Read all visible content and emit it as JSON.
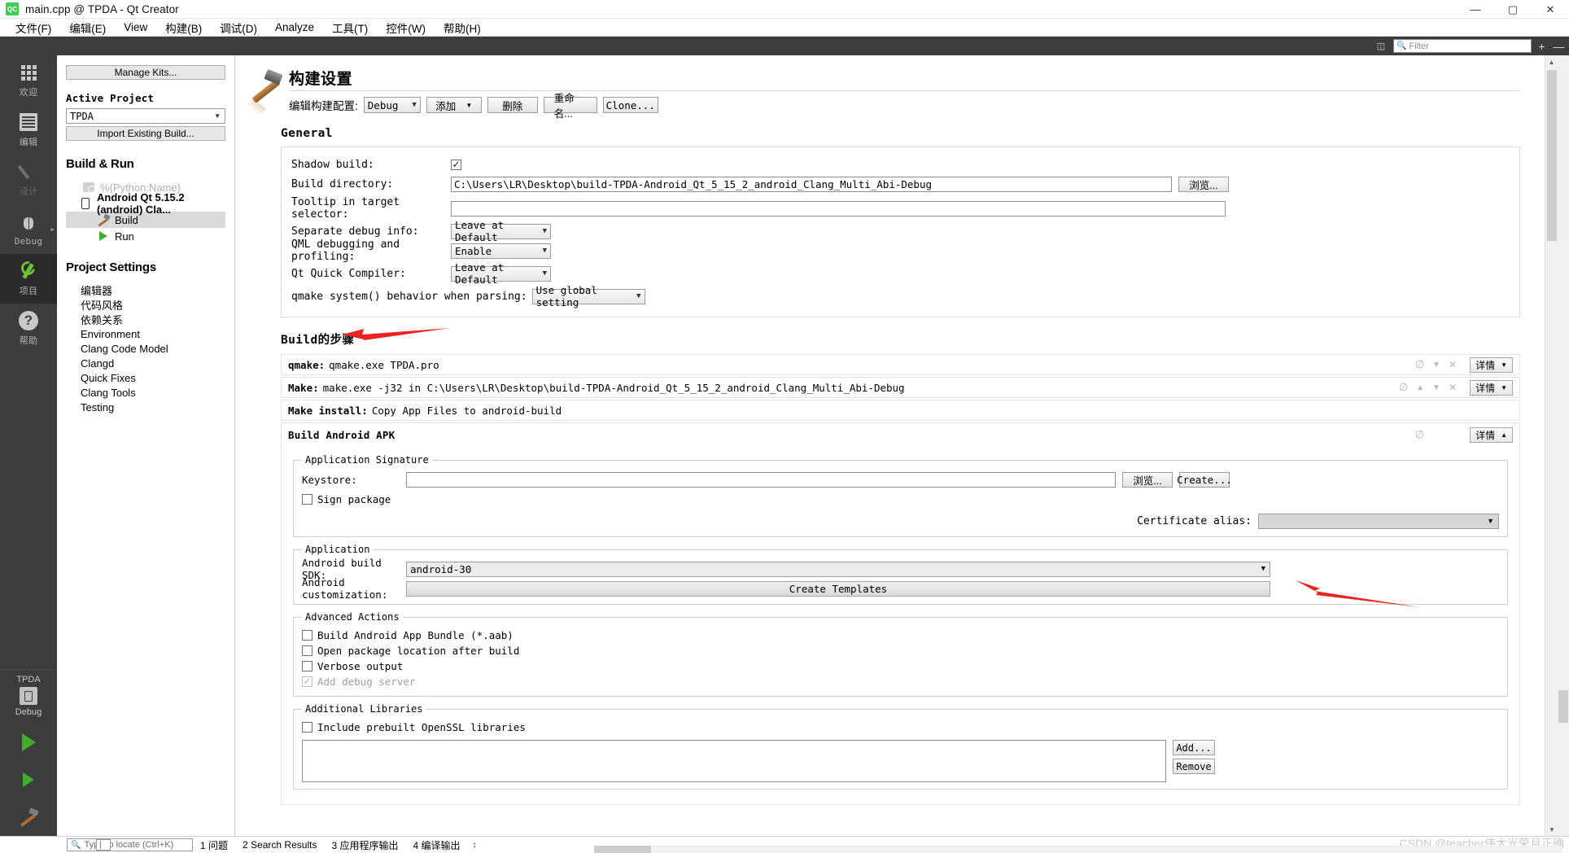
{
  "window": {
    "title": "main.cpp @ TPDA - Qt Creator",
    "app_icon": "qt-creator-icon",
    "minimize": "—",
    "maximize": "▢",
    "close": "✕"
  },
  "menubar": {
    "items": [
      {
        "label": "文件(F)"
      },
      {
        "label": "编辑(E)"
      },
      {
        "label": "View"
      },
      {
        "label": "构建(B)"
      },
      {
        "label": "调试(D)"
      },
      {
        "label": "Analyze"
      },
      {
        "label": "工具(T)"
      },
      {
        "label": "控件(W)"
      },
      {
        "label": "帮助(H)"
      }
    ]
  },
  "toolstrip": {
    "split_icon": "split-editor-icon",
    "filter_placeholder": "Filter",
    "search_icon": "search-icon",
    "add_label": "+",
    "remove_label": "—"
  },
  "modebar": {
    "items": [
      {
        "label": "欢迎",
        "icon": "grid-icon",
        "state": "normal"
      },
      {
        "label": "编辑",
        "icon": "document-icon",
        "state": "normal"
      },
      {
        "label": "设计",
        "icon": "pencil-icon",
        "state": "disabled"
      },
      {
        "label": "Debug",
        "icon": "bug-icon",
        "state": "normal"
      },
      {
        "label": "项目",
        "icon": "wrench-icon",
        "state": "active"
      },
      {
        "label": "帮助",
        "icon": "question-icon",
        "state": "normal"
      }
    ],
    "kit_selector": {
      "project": "TPDA",
      "config": "Debug",
      "icon": "target-selector-icon"
    },
    "run_button": "run-icon",
    "debug_button": "debug-icon",
    "build_button": "build-hammer-icon"
  },
  "project_panel": {
    "manage_kits_label": "Manage Kits...",
    "active_project_heading": "Active Project",
    "active_project_value": "TPDA",
    "import_existing_label": "Import Existing Build...",
    "build_run_heading": "Build & Run",
    "targets": [
      {
        "label": "%{Python:Name}",
        "icon": "python-kit-icon",
        "state": "dim"
      },
      {
        "label": "Android Qt 5.15.2 (android) Cla...",
        "icon": "android-device-icon",
        "state": "bold"
      },
      {
        "label": "Build",
        "icon": "hammer-icon",
        "state": "selected"
      },
      {
        "label": "Run",
        "icon": "run-triangle-icon",
        "state": "normal"
      }
    ],
    "project_settings_heading": "Project Settings",
    "settings_items": [
      {
        "label": "编辑器"
      },
      {
        "label": "代码风格"
      },
      {
        "label": "依赖关系"
      },
      {
        "label": "Environment"
      },
      {
        "label": "Clang Code Model"
      },
      {
        "label": "Clangd"
      },
      {
        "label": "Quick Fixes"
      },
      {
        "label": "Clang Tools"
      },
      {
        "label": "Testing"
      }
    ]
  },
  "build_settings": {
    "page_title": "构建设置",
    "page_icon": "hammer-icon",
    "edit_config_label": "编辑构建配置:",
    "config_value": "Debug",
    "buttons": {
      "add": "添加",
      "remove": "删除",
      "rename": "重命名...",
      "clone": "Clone..."
    },
    "general_heading": "General",
    "general_fields": {
      "shadow_build_label": "Shadow build:",
      "shadow_build_checked": true,
      "build_directory_label": "Build directory:",
      "build_directory_value": "C:\\Users\\LR\\Desktop\\build-TPDA-Android_Qt_5_15_2_android_Clang_Multi_Abi-Debug",
      "browse_label": "浏览...",
      "tooltip_label": "Tooltip in target selector:",
      "tooltip_value": "",
      "separate_debug_label": "Separate debug info:",
      "separate_debug_value": "Leave at Default",
      "qml_debug_label": "QML debugging and profiling:",
      "qml_debug_value": "Enable",
      "qt_quick_label": "Qt Quick Compiler:",
      "qt_quick_value": "Leave at Default",
      "qmake_system_label": "qmake system() behavior when parsing:",
      "qmake_system_value": "Use global setting"
    },
    "build_steps_heading": "Build的步骤",
    "detail_label": "详情",
    "steps": [
      {
        "name": "qmake:",
        "desc": "qmake.exe TPDA.pro",
        "has_controls": true
      },
      {
        "name": "Make:",
        "desc": "make.exe -j32 in C:\\Users\\LR\\Desktop\\build-TPDA-Android_Qt_5_15_2_android_Clang_Multi_Abi-Debug",
        "has_controls": true
      },
      {
        "name": "Make install:",
        "desc": "Copy App Files to android-build",
        "has_controls": false
      }
    ],
    "apk": {
      "title": "Build Android APK",
      "detail_label": "详情",
      "signature": {
        "legend": "Application Signature",
        "keystore_label": "Keystore:",
        "keystore_value": "",
        "browse_label": "浏览...",
        "create_label": "Create...",
        "sign_package_label": "Sign package",
        "sign_package_checked": false,
        "cert_alias_label": "Certificate alias:",
        "cert_alias_value": ""
      },
      "application": {
        "legend": "Application",
        "sdk_label": "Android build SDK:",
        "sdk_value": "android-30",
        "customization_label": "Android customization:",
        "create_templates_label": "Create Templates"
      },
      "advanced": {
        "legend": "Advanced Actions",
        "items": [
          {
            "label": "Build Android App Bundle (*.aab)",
            "checked": false,
            "disabled": false
          },
          {
            "label": "Open package location after build",
            "checked": false,
            "disabled": false
          },
          {
            "label": "Verbose output",
            "checked": false,
            "disabled": false
          },
          {
            "label": "Add debug server",
            "checked": true,
            "disabled": true
          }
        ]
      },
      "additional_libraries": {
        "legend": "Additional Libraries",
        "openssl_label": "Include prebuilt OpenSSL libraries",
        "openssl_checked": false,
        "add_label": "Add...",
        "remove_label": "Remove"
      }
    }
  },
  "statusbar": {
    "locator_placeholder": "Type to locate (Ctrl+K)",
    "search_icon": "search-icon",
    "panes": [
      {
        "num": "1",
        "label": "问题"
      },
      {
        "num": "2",
        "label": "Search Results"
      },
      {
        "num": "3",
        "label": "应用程序输出"
      },
      {
        "num": "4",
        "label": "编译输出"
      }
    ],
    "updown_icon": "updown-arrows-icon",
    "watermark": "CSDN @teacher伟大光荣且正确"
  },
  "colors": {
    "accent_green": "#41cd52",
    "mode_bar_bg": "#3c3c3c",
    "annotation_red": "#ef2222"
  }
}
